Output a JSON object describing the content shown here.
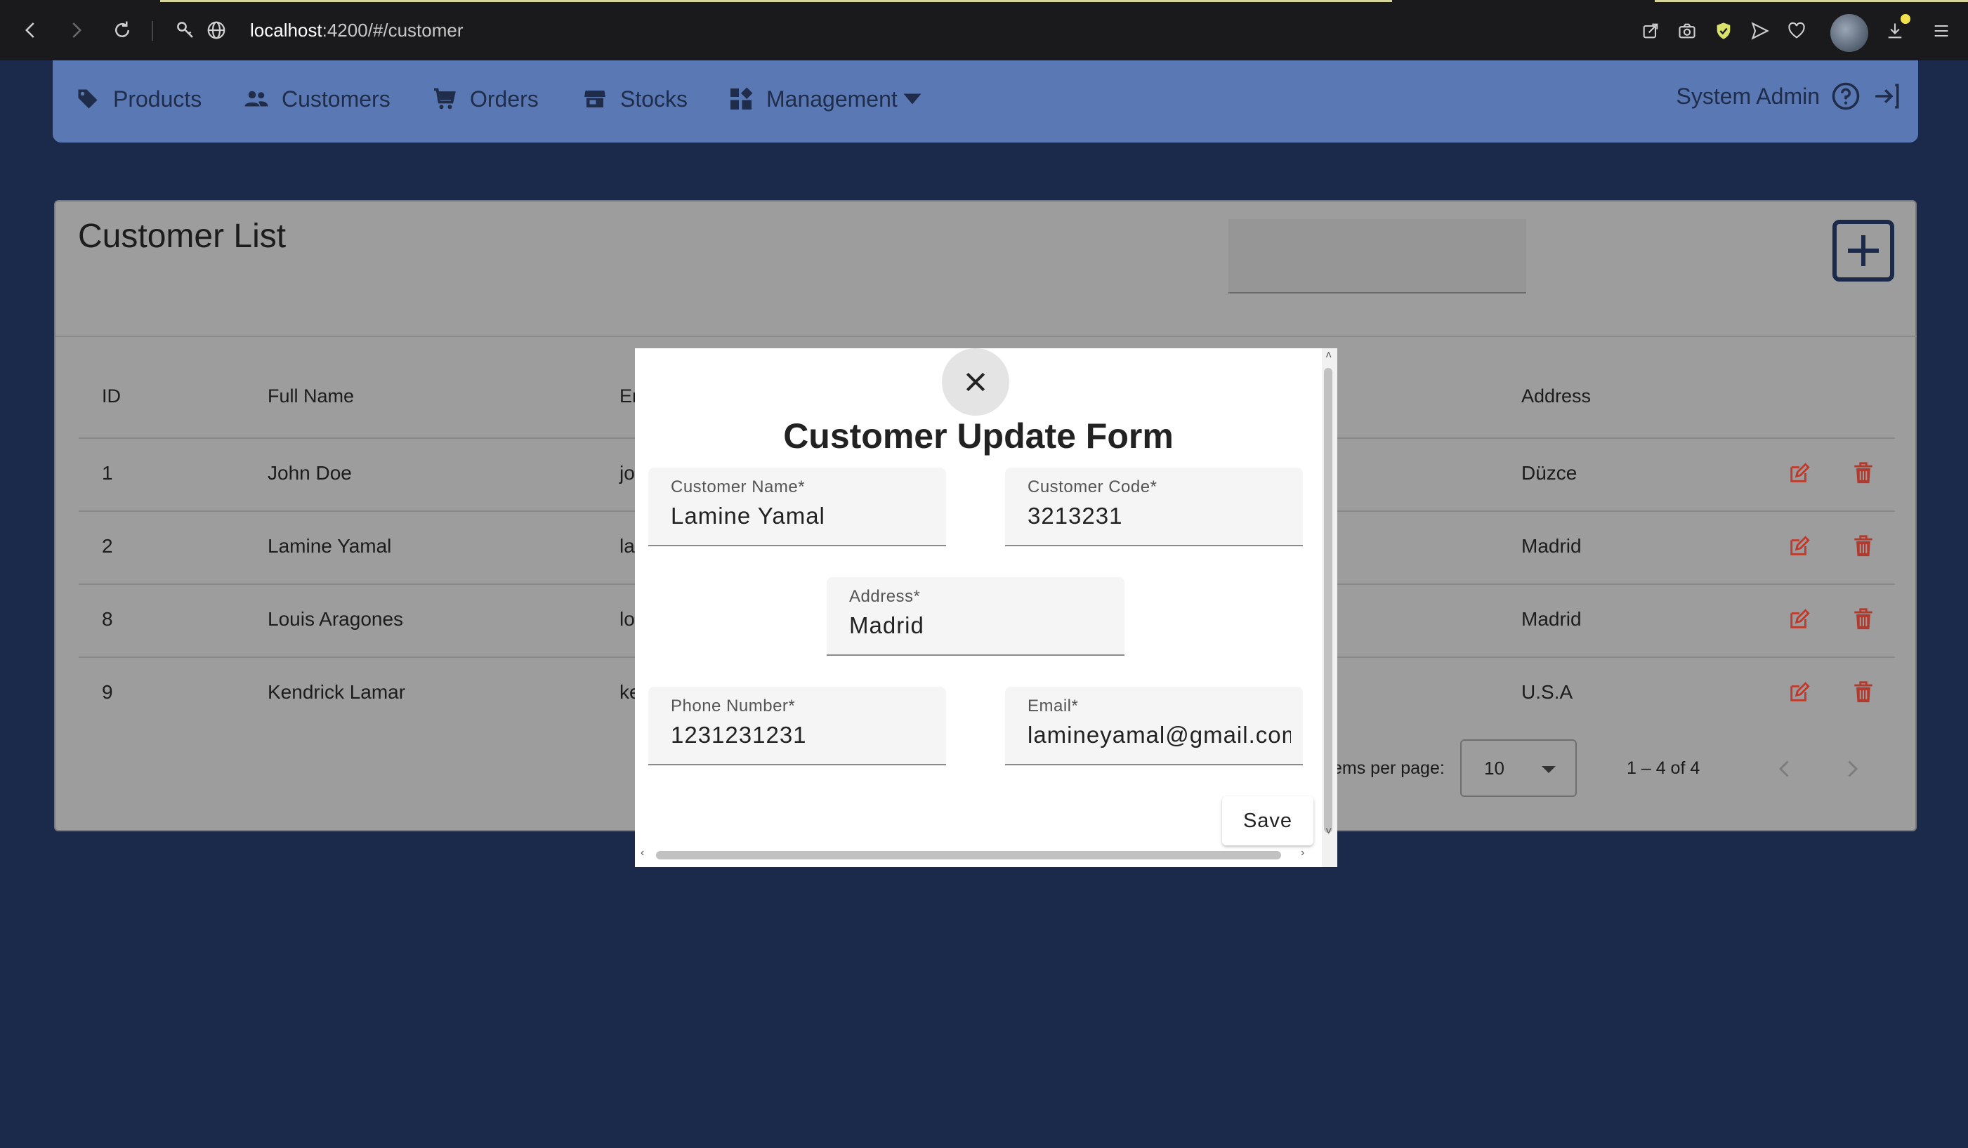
{
  "browser": {
    "url_host": "localhost",
    "url_rest": ":4200/#/customer"
  },
  "nav": {
    "items": [
      {
        "label": "Products",
        "icon": "tag-icon"
      },
      {
        "label": "Customers",
        "icon": "people-icon"
      },
      {
        "label": "Orders",
        "icon": "cart-icon"
      },
      {
        "label": "Stocks",
        "icon": "store-icon"
      },
      {
        "label": "Management",
        "icon": "widgets-icon"
      }
    ],
    "user": "System Admin"
  },
  "customer_list": {
    "title": "Customer List",
    "columns": [
      "ID",
      "Full Name",
      "Em",
      "Address"
    ],
    "rows": [
      {
        "id": "1",
        "name": "John Doe",
        "email": "jo",
        "address": "Düzce"
      },
      {
        "id": "2",
        "name": "Lamine Yamal",
        "email": "la",
        "address": "Madrid"
      },
      {
        "id": "8",
        "name": "Louis Aragones",
        "email": "lo",
        "address": "Madrid"
      },
      {
        "id": "9",
        "name": "Kendrick Lamar",
        "email": "ke",
        "address": "U.S.A"
      }
    ],
    "paginator": {
      "items_per_page_label": "ems per page:",
      "page_size": "10",
      "range": "1 – 4 of 4"
    }
  },
  "modal": {
    "title": "Customer Update Form",
    "fields": {
      "customer_name": {
        "label": "Customer Name*",
        "value": "Lamine Yamal"
      },
      "customer_code": {
        "label": "Customer Code*",
        "value": "3213231"
      },
      "address": {
        "label": "Address*",
        "value": "Madrid"
      },
      "phone": {
        "label": "Phone Number*",
        "value": "1231231231"
      },
      "email": {
        "label": "Email*",
        "value": "lamineyamal@gmail.com"
      }
    },
    "save_label": "Save"
  },
  "colors": {
    "page_bg": "#1b2a4a",
    "navbar": "#5a78b3",
    "edit_icon": "#c0392b",
    "delete_icon": "#b03a2e"
  }
}
